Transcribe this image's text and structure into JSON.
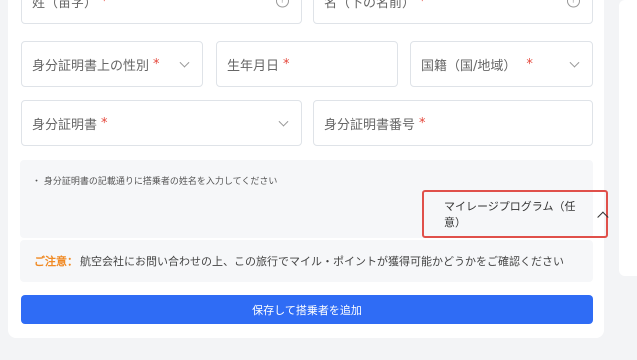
{
  "fields": {
    "last_name": "姓（苗字）",
    "first_name": "名（下の名前）",
    "gender": "身分証明書上の性別",
    "birthdate": "生年月日",
    "nationality": "国籍（国/地域）",
    "id_type": "身分証明書",
    "id_number": "身分証明書番号",
    "required_mark": "*",
    "help_glyph": "?"
  },
  "note": {
    "text": "・ 身分証明書の記載通りに搭乗者の姓名を入力してください"
  },
  "mileage": {
    "label": "マイレージプログラム（任意）"
  },
  "caution": {
    "label": "ご注意：",
    "text": "航空会社にお問い合わせの上、この旅行でマイル・ポイントが獲得可能かどうかをご確認ください"
  },
  "actions": {
    "save_label": "保存して搭乗者を追加"
  },
  "colors": {
    "primary": "#2f6cf5",
    "required": "#e5463a",
    "caution": "#f08a24",
    "highlight": "#e0504a"
  }
}
